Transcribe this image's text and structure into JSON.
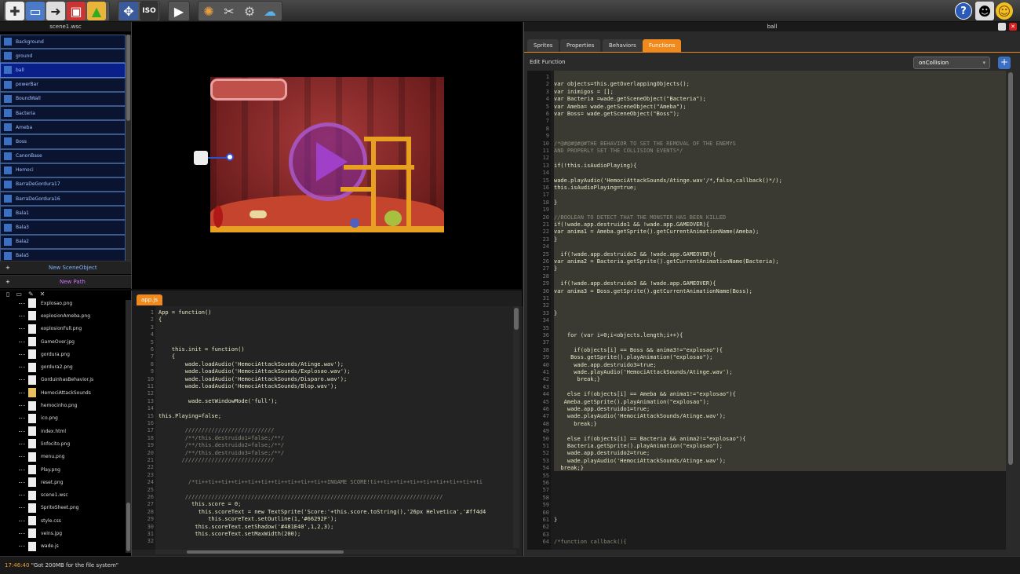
{
  "toolbar": {
    "left_icons": [
      "new-file-icon",
      "open-folder-icon",
      "import-icon",
      "save-icon",
      "publish-icon"
    ],
    "view_icons": [
      "move-icon",
      "iso-icon"
    ],
    "iso_label": "ISO",
    "play_label": "▶",
    "right_icons": [
      "help-icon",
      "avatar-icon",
      "smiley-icon"
    ]
  },
  "scene": {
    "title": "scene1.wsc",
    "objects": [
      "Background",
      "ground",
      "ball",
      "powerBar",
      "BoundWall",
      "Bacteria",
      "Ameba",
      "Boss",
      "CanonBase",
      "Hemoci",
      "BarraDeGordura17",
      "BarraDeGordura16",
      "Bala1",
      "Bala3",
      "Bala2",
      "Bala5"
    ],
    "selected": "ball",
    "new_scene_object": "New SceneObject",
    "new_path": "New Path"
  },
  "files": {
    "items": [
      "Explosao.png",
      "explosionAmeba.png",
      "explosionFull.png",
      "GameOver.jpg",
      "gordura.png",
      "gordura2.png",
      "GorduinhasBehavior.js",
      "HemociAttackSounds",
      "hemocinho.png",
      "ico.png",
      "index.html",
      "linfocito.png",
      "menu.png",
      "Play.png",
      "reset.png",
      "scene1.wsc",
      "SpriteSheet.png",
      "style.css",
      "veins.jpg",
      "wade.js"
    ]
  },
  "editor": {
    "tab": "app.js",
    "lines": [
      "App = function()",
      "{",
      "",
      "",
      "",
      "    this.init = function()",
      "    {",
      "        wade.loadAudio('HemociAttackSounds/Atinge.wav');",
      "        wade.loadAudio('HemociAttackSounds/Explosao.wav');",
      "        wade.loadAudio('HemociAttackSounds/Disparo.wav');",
      "        wade.loadAudio('HemociAttackSounds/Blop.wav');",
      "",
      "         wade.setWindowMode('full');",
      "",
      "this.Playing=false;",
      "",
      "        ///////////////////////////",
      "        /**/this.destruido1=false;/**/",
      "        /**/this.destruido2=false;/**/",
      "        /**/this.destruido3=false;/**/",
      "       ////////////////////////////",
      "",
      "",
      "         /*ti++ti++ti++ti++ti++ti++ti++ti++ti++ti++INGAME SCORE!ti++ti++ti++ti++ti++ti++ti++ti++ti",
      "",
      "        //////////////////////////////////////////////////////////////////////////////",
      "          this.score = 0;",
      "            this.scoreText = new TextSprite('Score:'+this.score.toString(),'26px Helvetica','#ff4d4",
      "               this.scoreText.setOutline(1,'#66292F');",
      "           this.scoreText.setShadow('#481E40',1,2,3);",
      "           this.scoreText.setMaxWidth(200);",
      ""
    ]
  },
  "right": {
    "title": "ball",
    "tabs": [
      "Sprites",
      "Properties",
      "Behaviors",
      "Functions"
    ],
    "active_tab": "Functions",
    "edit_label": "Edit Function",
    "function_select": "onCollision",
    "add_label": "+",
    "lines": [
      "",
      "var objects=this.getOverlappingObjects();",
      "var inimigos = [];",
      "var Bacteria =wade.getSceneObject(\"Bacteria\");",
      "var Ameba= wade.getSceneObject(\"Ameba\");",
      "var Boss= wade.getSceneObject(\"Boss\");",
      "",
      "",
      "",
      "/*@#@#@#@#THE BEHAVIOR TO SET THE REMOVAL OF THE ENEMYS",
      "AND PROPERLY SET THE COLLISION EVENTS*/",
      "",
      "if(!this.isAudioPlaying){",
      "",
      "wade.playAudio('HemociAttackSounds/Atinge.wav'/*,false,callback()*/);",
      "this.isAudioPlaying=true;",
      "",
      "}",
      "",
      "//BOOLEAN TO DETECT THAT THE MONSTER HAS BEEN KILLED",
      "if(!wade.app.destruido1 && !wade.app.GAMEOVER){",
      "var anima1 = Ameba.getSprite().getCurrentAnimationName(Ameba);",
      "}",
      "",
      "  if(!wade.app.destruido2 && !wade.app.GAMEOVER){",
      "var anima2 = Bacteria.getSprite().getCurrentAnimationName(Bacteria);",
      "}",
      "",
      "  if(!wade.app.destruido3 && !wade.app.GAMEOVER){",
      "var anima3 = Boss.getSprite().getCurrentAnimationName(Boss);",
      "",
      "",
      "}",
      "",
      "",
      "    for (var i=0;i<objects.length;i++){",
      "",
      "      if(objects[i] == Boss && anima3!=\"explosao\"){",
      "     Boss.getSprite().playAnimation(\"explosao\");",
      "      wade.app.destruido3=true;",
      "      wade.playAudio('HemociAttackSounds/Atinge.wav');",
      "       break;}",
      "",
      "    else if(objects[i] == Ameba && anima1!=\"explosao\"){",
      "   Ameba.getSprite().playAnimation(\"explosao\");",
      "    wade.app.destruido1=true;",
      "    wade.playAudio('HemociAttackSounds/Atinge.wav');",
      "      break;}",
      "",
      "    else if(objects[i] == Bacteria && anima2!=\"explosao\"){",
      "    Bacteria.getSprite().playAnimation(\"explosao\");",
      "    wade.app.destruido2=true;",
      "    wade.playAudio('HemociAttackSounds/Atinge.wav');",
      "  break;}",
      "",
      "",
      "",
      "",
      "",
      "",
      "}",
      "",
      "",
      "/*function callback(){"
    ]
  },
  "status": {
    "time": "17:46:40",
    "message": "\"Got 200MB for the file system\""
  },
  "colors": {
    "accent": "#f08a1c",
    "selection": "#0b1f8a"
  }
}
